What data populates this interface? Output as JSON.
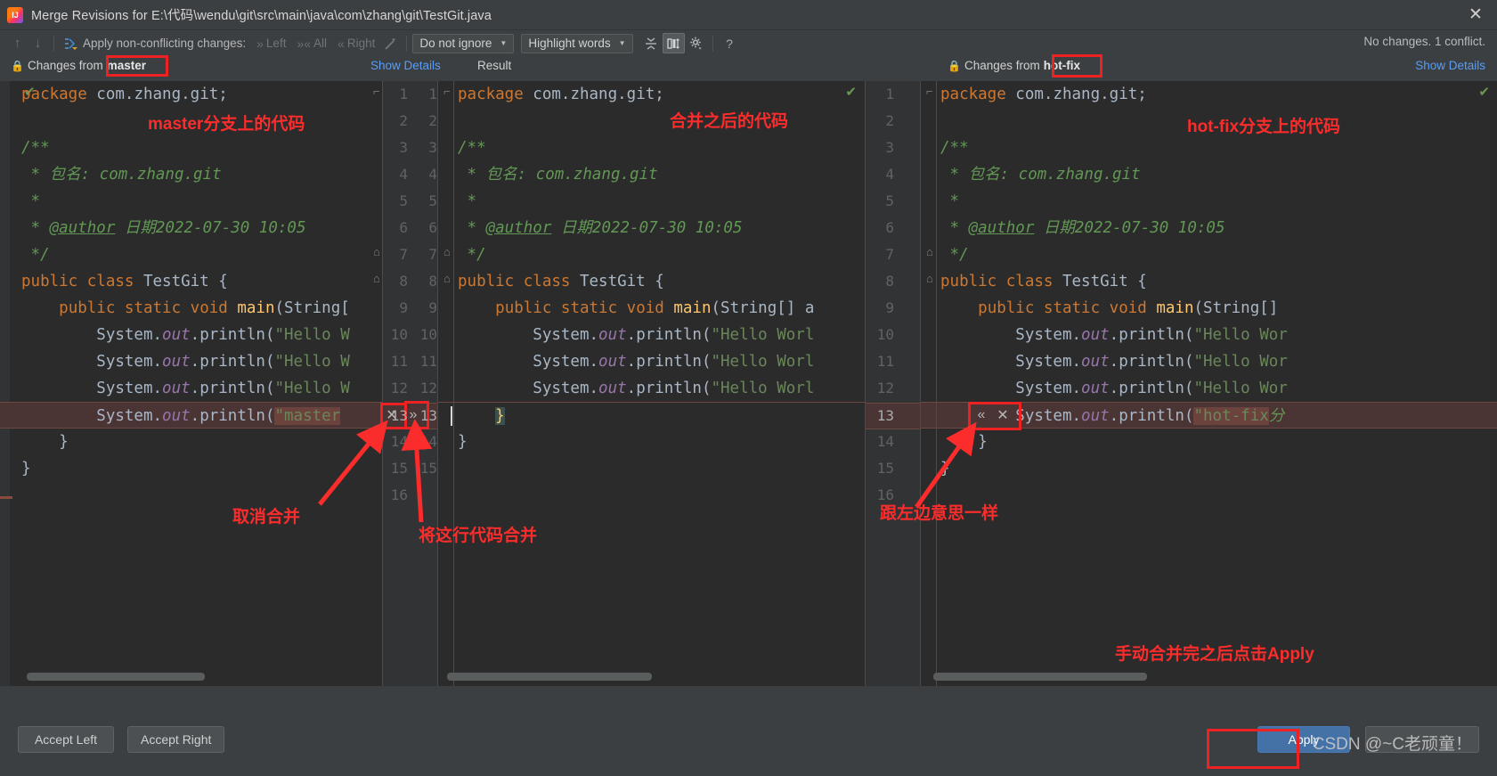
{
  "window": {
    "title": "Merge Revisions for E:\\代码\\wendu\\git\\src\\main\\java\\com\\zhang\\git\\TestGit.java",
    "close_icon": "✕",
    "app_icon": "intellij-idea-icon"
  },
  "toolbar": {
    "prev_icon": "↑",
    "next_icon": "↓",
    "apply_all_icon": "⚡",
    "apply_label": "Apply non-conflicting changes:",
    "left_label": "Left",
    "all_label": "All",
    "right_label": "Right",
    "magic_icon": "magic-wand-icon",
    "ignore_combo": "Do not ignore",
    "highlight_combo": "Highlight words",
    "collapse_icon": "collapse-unchanged-icon",
    "align_icon": "align-panes-icon",
    "settings_icon": "gear-icon",
    "help_icon": "?",
    "status": "No changes. 1 conflict.",
    "caret": "▼"
  },
  "subheader": {
    "left_prefix": "Changes from",
    "left_branch": "master",
    "left_show_details": "Show Details",
    "result_label": "Result",
    "right_prefix": "Changes from",
    "right_branch": "hot-fix",
    "right_show_details": "Show Details",
    "lock_icon": "lock-icon"
  },
  "left_pane": {
    "name": "master",
    "line_numbers": [
      "1",
      "2",
      "3",
      "4",
      "5",
      "6",
      "7",
      "8",
      "9",
      "10",
      "11",
      "12",
      "13",
      "14",
      "15"
    ],
    "lines": [
      {
        "n": "1",
        "t": "package com.zhang.git;"
      },
      {
        "n": "2",
        "t": ""
      },
      {
        "n": "3",
        "t": "/**"
      },
      {
        "n": "4",
        "t": " * 包名: com.zhang.git"
      },
      {
        "n": "5",
        "t": " *"
      },
      {
        "n": "6",
        "t": " * @author 日期2022-07-30 10:05"
      },
      {
        "n": "7",
        "t": " */"
      },
      {
        "n": "8",
        "t": "public class TestGit {"
      },
      {
        "n": "9",
        "t": "    public static void main(String["
      },
      {
        "n": "10",
        "t": "        System.out.println(\"Hello W"
      },
      {
        "n": "11",
        "t": "        System.out.println(\"Hello W"
      },
      {
        "n": "12",
        "t": "        System.out.println(\"Hello W"
      },
      {
        "n": "13",
        "t": "        System.out.println(\"master",
        "conflict": true
      },
      {
        "n": "14",
        "t": "    }"
      },
      {
        "n": "15",
        "t": "}"
      }
    ]
  },
  "result_pane": {
    "name": "Result",
    "line_numbers": [
      "1",
      "2",
      "3",
      "4",
      "5",
      "6",
      "7",
      "8",
      "9",
      "10",
      "11",
      "12",
      "13",
      "14",
      "15",
      "16"
    ],
    "lines": [
      {
        "n": "1",
        "t": "package com.zhang.git;"
      },
      {
        "n": "2",
        "t": ""
      },
      {
        "n": "3",
        "t": "/**"
      },
      {
        "n": "4",
        "t": " * 包名: com.zhang.git"
      },
      {
        "n": "5",
        "t": " *"
      },
      {
        "n": "6",
        "t": " * @author 日期2022-07-30 10:05"
      },
      {
        "n": "7",
        "t": " */"
      },
      {
        "n": "8",
        "t": "public class TestGit {"
      },
      {
        "n": "9",
        "t": "    public static void main(String[] a"
      },
      {
        "n": "10",
        "t": "        System.out.println(\"Hello Worl"
      },
      {
        "n": "11",
        "t": "        System.out.println(\"Hello Worl"
      },
      {
        "n": "12",
        "t": "        System.out.println(\"Hello Worl"
      },
      {
        "n": "13",
        "t": "    }",
        "caret": true
      },
      {
        "n": "14",
        "t": "}"
      }
    ]
  },
  "right_pane": {
    "name": "hot-fix",
    "line_numbers": [
      "1",
      "2",
      "3",
      "4",
      "5",
      "6",
      "7",
      "8",
      "9",
      "10",
      "11",
      "12",
      "13",
      "14",
      "15",
      "16"
    ],
    "lines": [
      {
        "n": "1",
        "t": "package com.zhang.git;"
      },
      {
        "n": "2",
        "t": ""
      },
      {
        "n": "3",
        "t": "/**"
      },
      {
        "n": "4",
        "t": " * 包名: com.zhang.git"
      },
      {
        "n": "5",
        "t": " *"
      },
      {
        "n": "6",
        "t": " * @author 日期2022-07-30 10:05"
      },
      {
        "n": "7",
        "t": " */"
      },
      {
        "n": "8",
        "t": "public class TestGit {"
      },
      {
        "n": "9",
        "t": "    public static void main(String[]"
      },
      {
        "n": "10",
        "t": "        System.out.println(\"Hello Wor"
      },
      {
        "n": "11",
        "t": "        System.out.println(\"Hello Wor"
      },
      {
        "n": "12",
        "t": "        System.out.println(\"Hello Wor"
      },
      {
        "n": "13",
        "t": "        System.out.println(\"hot-fix分",
        "conflict": true
      },
      {
        "n": "14",
        "t": "    }"
      },
      {
        "n": "15",
        "t": "}"
      }
    ]
  },
  "conflict_actions": {
    "left_revert_icon": "✕",
    "left_apply_icon": "»",
    "right_apply_icon": "«",
    "right_revert_icon": "✕",
    "conflict_line": "13"
  },
  "annotations": {
    "left_code_note": "master分支上的代码",
    "result_code_note": "合并之后的代码",
    "right_code_note": "hot-fix分支上的代码",
    "cancel_merge": "取消合并",
    "merge_this_line": "将这行代码合并",
    "same_as_left": "跟左边意思一样",
    "apply_note": "手动合并完之后点击Apply"
  },
  "bottom": {
    "accept_left": "Accept Left",
    "accept_right": "Accept Right",
    "apply": "Apply",
    "watermark": "CSDN @~C老顽童！"
  },
  "colors": {
    "accent_blue": "#589df6",
    "annotation_red": "#fb2c2c",
    "box_red": "#ee2222",
    "editor_bg": "#2b2b2b",
    "panel_bg": "#3c3f41",
    "conflict_bg": "#4b3434",
    "primary_button": "#4471a6"
  }
}
